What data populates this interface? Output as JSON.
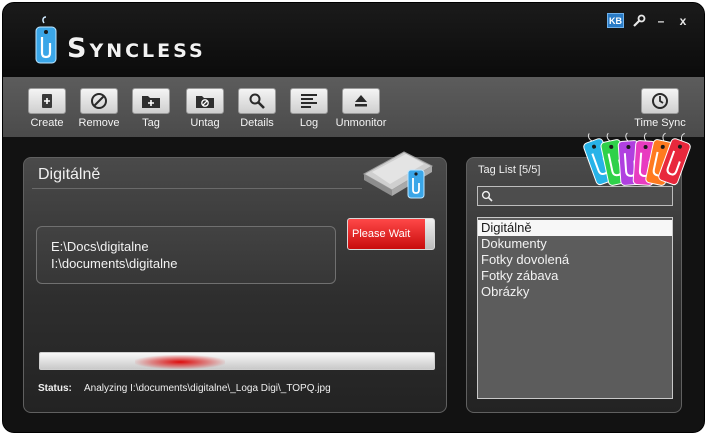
{
  "app": {
    "title": "Syncless",
    "kb_badge": "KB",
    "minimize_label": "–",
    "close_label": "x"
  },
  "toolbar": {
    "buttons": [
      {
        "label": "Create",
        "icon": "create-file-icon"
      },
      {
        "label": "Remove",
        "icon": "remove-circle-icon"
      },
      {
        "label": "Tag",
        "icon": "tag-folder-icon"
      },
      {
        "label": "Untag",
        "icon": "untag-folder-icon"
      },
      {
        "label": "Details",
        "icon": "magnifier-icon"
      },
      {
        "label": "Log",
        "icon": "log-lines-icon"
      },
      {
        "label": "Unmonitor",
        "icon": "eject-icon"
      }
    ],
    "time_sync": {
      "label": "Time Sync",
      "icon": "clock-icon"
    }
  },
  "main_panel": {
    "title": "Digitálně",
    "folders": [
      "E:\\Docs\\digitalne",
      "I:\\documents\\digitalne"
    ],
    "wait_button": {
      "label": "Please Wait",
      "progress": 0.9
    },
    "status_label": "Status:",
    "status_text": "Analyzing I:\\documents\\digitalne\\_Loga Digi\\_TOPQ.jpg"
  },
  "tag_panel": {
    "title": "Tag List [5/5]",
    "search_value": "",
    "tags": [
      "Digitálně",
      "Dokumenty",
      "Fotky dovolená",
      "Fotky zábava",
      "Obrázky"
    ],
    "selected_index": 0
  },
  "colors": {
    "accent_red": "#e01818",
    "kb_blue": "#2a7cc7",
    "tag_blue": "#3aa6e8",
    "deco_tags": [
      "#27b3e8",
      "#2fd14a",
      "#b040e0",
      "#e83cc0",
      "#ff7a20",
      "#e8283c"
    ]
  }
}
